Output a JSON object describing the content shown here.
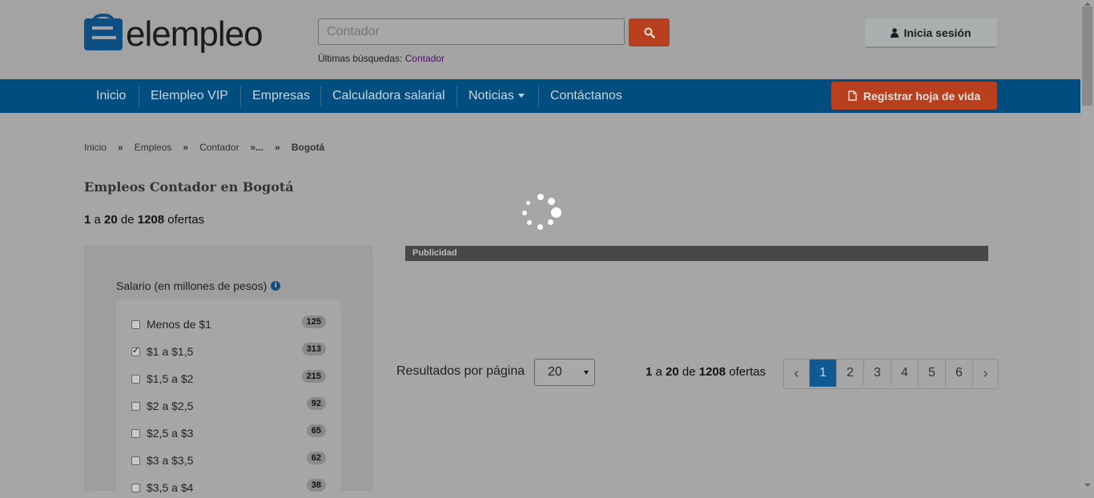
{
  "header": {
    "logo_text": "elempleo",
    "search_placeholder": "Contador",
    "recent_label": "Últimas búsquedas:",
    "recent_link": "Contador",
    "login_label": "Inicia sesión"
  },
  "nav": {
    "items": [
      {
        "label": "Inicio"
      },
      {
        "label": "Elempleo VIP"
      },
      {
        "label": "Empresas"
      },
      {
        "label": "Calculadora salarial"
      },
      {
        "label": "Noticias"
      },
      {
        "label": "Contáctanos"
      }
    ],
    "register_label": "Registrar hoja de vida"
  },
  "breadcrumb": {
    "items": [
      "Inicio",
      "Empleos",
      "Contador",
      "...",
      "Bogotá"
    ],
    "separator": "»"
  },
  "main": {
    "title": "Empleos Contador en Bogotá",
    "count": {
      "from": "1",
      "a": "a",
      "to": "20",
      "de": "de",
      "total": "1208",
      "suffix": "ofertas"
    }
  },
  "filter": {
    "title": "Salario (en millones de pesos)",
    "info_icon": "info-icon",
    "options": [
      {
        "label": "Menos de $1",
        "count": "125",
        "checked": false
      },
      {
        "label": "$1 a $1,5",
        "count": "313",
        "checked": true
      },
      {
        "label": "$1,5 a $2",
        "count": "215",
        "checked": false
      },
      {
        "label": "$2 a $2,5",
        "count": "92",
        "checked": false
      },
      {
        "label": "$2,5 a $3",
        "count": "65",
        "checked": false
      },
      {
        "label": "$3 a $3,5",
        "count": "62",
        "checked": false
      },
      {
        "label": "$3,5 a $4",
        "count": "38",
        "checked": false
      }
    ]
  },
  "ad": {
    "label": "Publicidad"
  },
  "results": {
    "per_page_label": "Resultados por página",
    "per_page_value": "20"
  },
  "pagination": {
    "prev": "‹",
    "next": "›",
    "pages": [
      "1",
      "2",
      "3",
      "4",
      "5",
      "6"
    ],
    "active": "1"
  },
  "colors": {
    "nav": "#004d80",
    "accent": "#b8401f",
    "active_page": "#0d5a96"
  }
}
